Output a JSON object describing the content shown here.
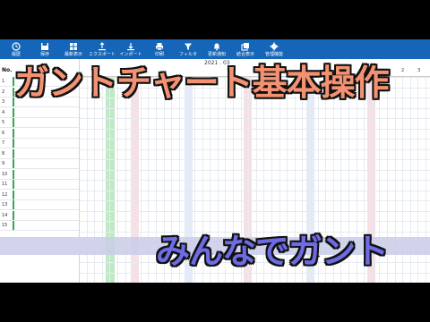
{
  "toolbar": {
    "buttons": [
      {
        "label": "履歴",
        "icon": "history-icon"
      },
      {
        "label": "保存",
        "icon": "save-icon"
      },
      {
        "label": "最新表示",
        "icon": "refresh-icon"
      },
      {
        "label": "エクスポート",
        "icon": "export-icon"
      },
      {
        "label": "インポート",
        "icon": "import-icon"
      },
      {
        "label": "印刷",
        "icon": "print-icon"
      },
      {
        "label": "フィルタ",
        "icon": "filter-icon"
      },
      {
        "label": "更新通知",
        "icon": "notification-icon"
      },
      {
        "label": "結合表示",
        "icon": "merge-view-icon"
      },
      {
        "label": "管理機能",
        "icon": "gear-icon"
      }
    ]
  },
  "grid": {
    "date_label": "2021 . 03",
    "no_header": "No.",
    "row_numbers": [
      "1",
      "2",
      "3",
      "4",
      "5",
      "6",
      "7",
      "8",
      "9",
      "10",
      "11",
      "12",
      "13",
      "14",
      "15"
    ],
    "day_numbers_right": [
      "2",
      "3"
    ]
  },
  "overlay": {
    "title": "ガントチャート基本操作",
    "subtitle": "みんなでガント"
  },
  "colors": {
    "toolbar_bg": "#1565b8",
    "title_fill": "#f39273",
    "subtitle_fill": "#6e6ce4",
    "weekend_green": "#bfe9c4",
    "weekend_red": "#f6dfe5",
    "selection_band": "#c9cde8"
  }
}
